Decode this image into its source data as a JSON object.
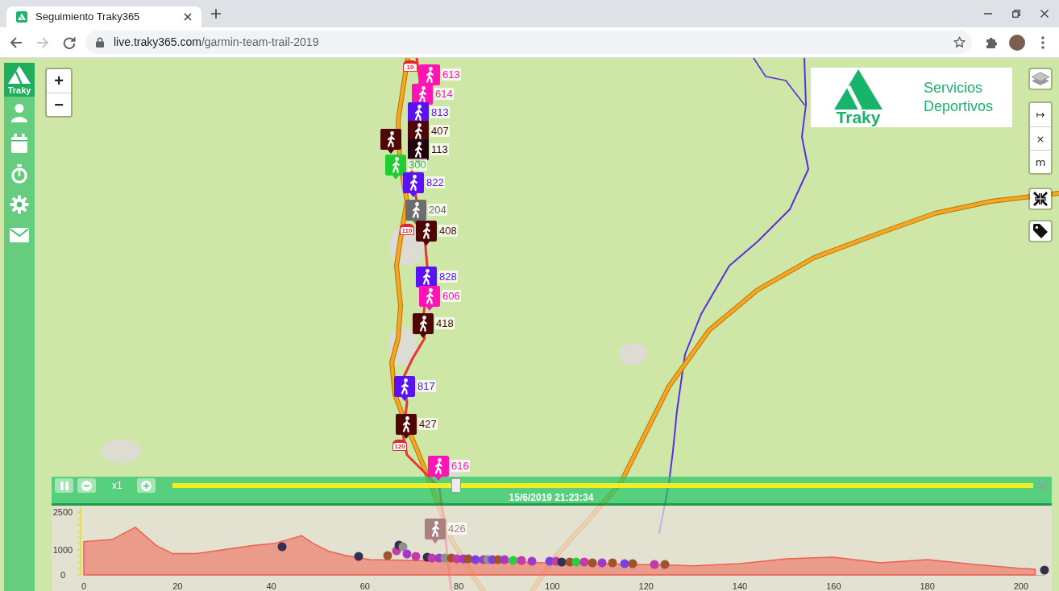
{
  "browser": {
    "tab_title": "Seguimiento Traky365",
    "nav_buttons": [
      {
        "kind": "back",
        "disabled": false
      },
      {
        "kind": "forward",
        "disabled": true
      },
      {
        "kind": "reload",
        "disabled": false
      }
    ],
    "address": {
      "domain": "live.traky365.com",
      "path": "/garmin-team-trail-2019"
    }
  },
  "sidebar": {
    "brand": "Traky",
    "items": [
      {
        "kind": "user"
      },
      {
        "kind": "calendar"
      },
      {
        "kind": "stopwatch"
      },
      {
        "kind": "settings"
      },
      {
        "kind": "mail"
      }
    ]
  },
  "zoom_buttons": [
    "+",
    "−"
  ],
  "km_markers": [
    "10",
    "110",
    "120"
  ],
  "runners": [
    {
      "number": "613",
      "color": "#ff12b6"
    },
    {
      "number": "614",
      "color": "#ff12b6"
    },
    {
      "number": "813",
      "color": "#5a12f2"
    },
    {
      "number": "407",
      "color": "#4f0606"
    },
    {
      "color": "#4f0606"
    },
    {
      "number": "113",
      "color": "#22000e"
    },
    {
      "number": "300",
      "color": "#22cc33"
    },
    {
      "number": "822",
      "color": "#5a12f2"
    },
    {
      "number": "204",
      "color": "#6d6d6d"
    },
    {
      "number": "408",
      "color": "#4f0606"
    },
    {
      "number": "828",
      "color": "#5a12f2"
    },
    {
      "number": "606",
      "color": "#ff12b6"
    },
    {
      "number": "418",
      "color": "#4f0606"
    },
    {
      "number": "817",
      "color": "#5a12f2"
    },
    {
      "number": "427",
      "color": "#4f0606"
    },
    {
      "number": "616",
      "color": "#ff12b6"
    },
    {
      "number": "426",
      "color": "#a98181"
    }
  ],
  "logo_panel": {
    "brand": "Traky",
    "tagline": "Servicios Deportivos"
  },
  "map_controls": [
    {
      "kind": "layers"
    },
    {
      "kind": "group",
      "buttons": [
        "↦",
        "×",
        "m"
      ]
    },
    {
      "kind": "collapse"
    },
    {
      "kind": "tag"
    }
  ],
  "playback": {
    "controls": [
      {
        "kind": "pause"
      },
      {
        "kind": "minus"
      },
      {
        "kind": "speed",
        "label": "x1"
      },
      {
        "kind": "plus"
      }
    ],
    "level": 0.33,
    "timestamp": "15/6/2019 21:23:34"
  },
  "elevation_profile": {
    "chart_data": {
      "type": "area",
      "x": [
        0,
        6,
        11,
        15.5,
        19,
        24,
        30,
        36,
        40.5,
        46.5,
        49,
        52.5,
        56,
        61,
        126.5,
        130,
        140,
        150,
        160,
        170,
        180,
        190,
        200,
        203
      ],
      "series": [
        {
          "color": "#f0604f",
          "values": [
            1330,
            1410,
            1900,
            1170,
            850,
            850,
            1010,
            1170,
            1250,
            1570,
            1250,
            930,
            770,
            610,
            390,
            360,
            450,
            640,
            710,
            480,
            610,
            420,
            260,
            225
          ]
        }
      ],
      "xlim": [
        0,
        205
      ],
      "ylim": [
        0,
        2700
      ],
      "xticks": [
        0,
        20,
        40,
        60,
        80,
        100,
        120,
        140,
        160,
        180,
        200
      ],
      "yticks": [
        0,
        1000,
        2500
      ]
    },
    "dots": [
      {
        "color": "#35304f"
      },
      {
        "color": "#35304f"
      },
      {
        "color": "#a0522d"
      },
      {
        "color": "#c43aa8"
      },
      {
        "color": "#35304f"
      },
      {
        "color": "#8e8e8e"
      },
      {
        "color": "#a238c8"
      },
      {
        "color": "#c43aa8"
      },
      {
        "color": "#35304f"
      },
      {
        "color": "#c43aa8"
      },
      {
        "color": "#a238c8"
      },
      {
        "color": "#8e8e8e"
      },
      {
        "color": "#a0522d"
      },
      {
        "color": "#c43aa8"
      },
      {
        "color": "#a238c8"
      },
      {
        "color": "#a0522d"
      },
      {
        "color": "#7b3fe4"
      },
      {
        "color": "#a238c8"
      },
      {
        "color": "#8e8e8e"
      },
      {
        "color": "#7b3fe4"
      },
      {
        "color": "#a0522d"
      },
      {
        "color": "#a238c8"
      },
      {
        "color": "#2ecc40"
      },
      {
        "color": "#c43aa8"
      },
      {
        "color": "#a238c8"
      },
      {
        "color": "#7b3fe4"
      },
      {
        "color": "#c43aa8"
      },
      {
        "color": "#35304f"
      },
      {
        "color": "#a0522d"
      },
      {
        "color": "#2ecc40"
      },
      {
        "color": "#c43aa8"
      },
      {
        "color": "#a0522d"
      },
      {
        "color": "#a238c8"
      },
      {
        "color": "#a0522d"
      },
      {
        "color": "#7b3fe4"
      },
      {
        "color": "#a0522d"
      },
      {
        "color": "#c43aa8"
      },
      {
        "color": "#a0522d"
      },
      {
        "color": "#35304f"
      }
    ]
  }
}
